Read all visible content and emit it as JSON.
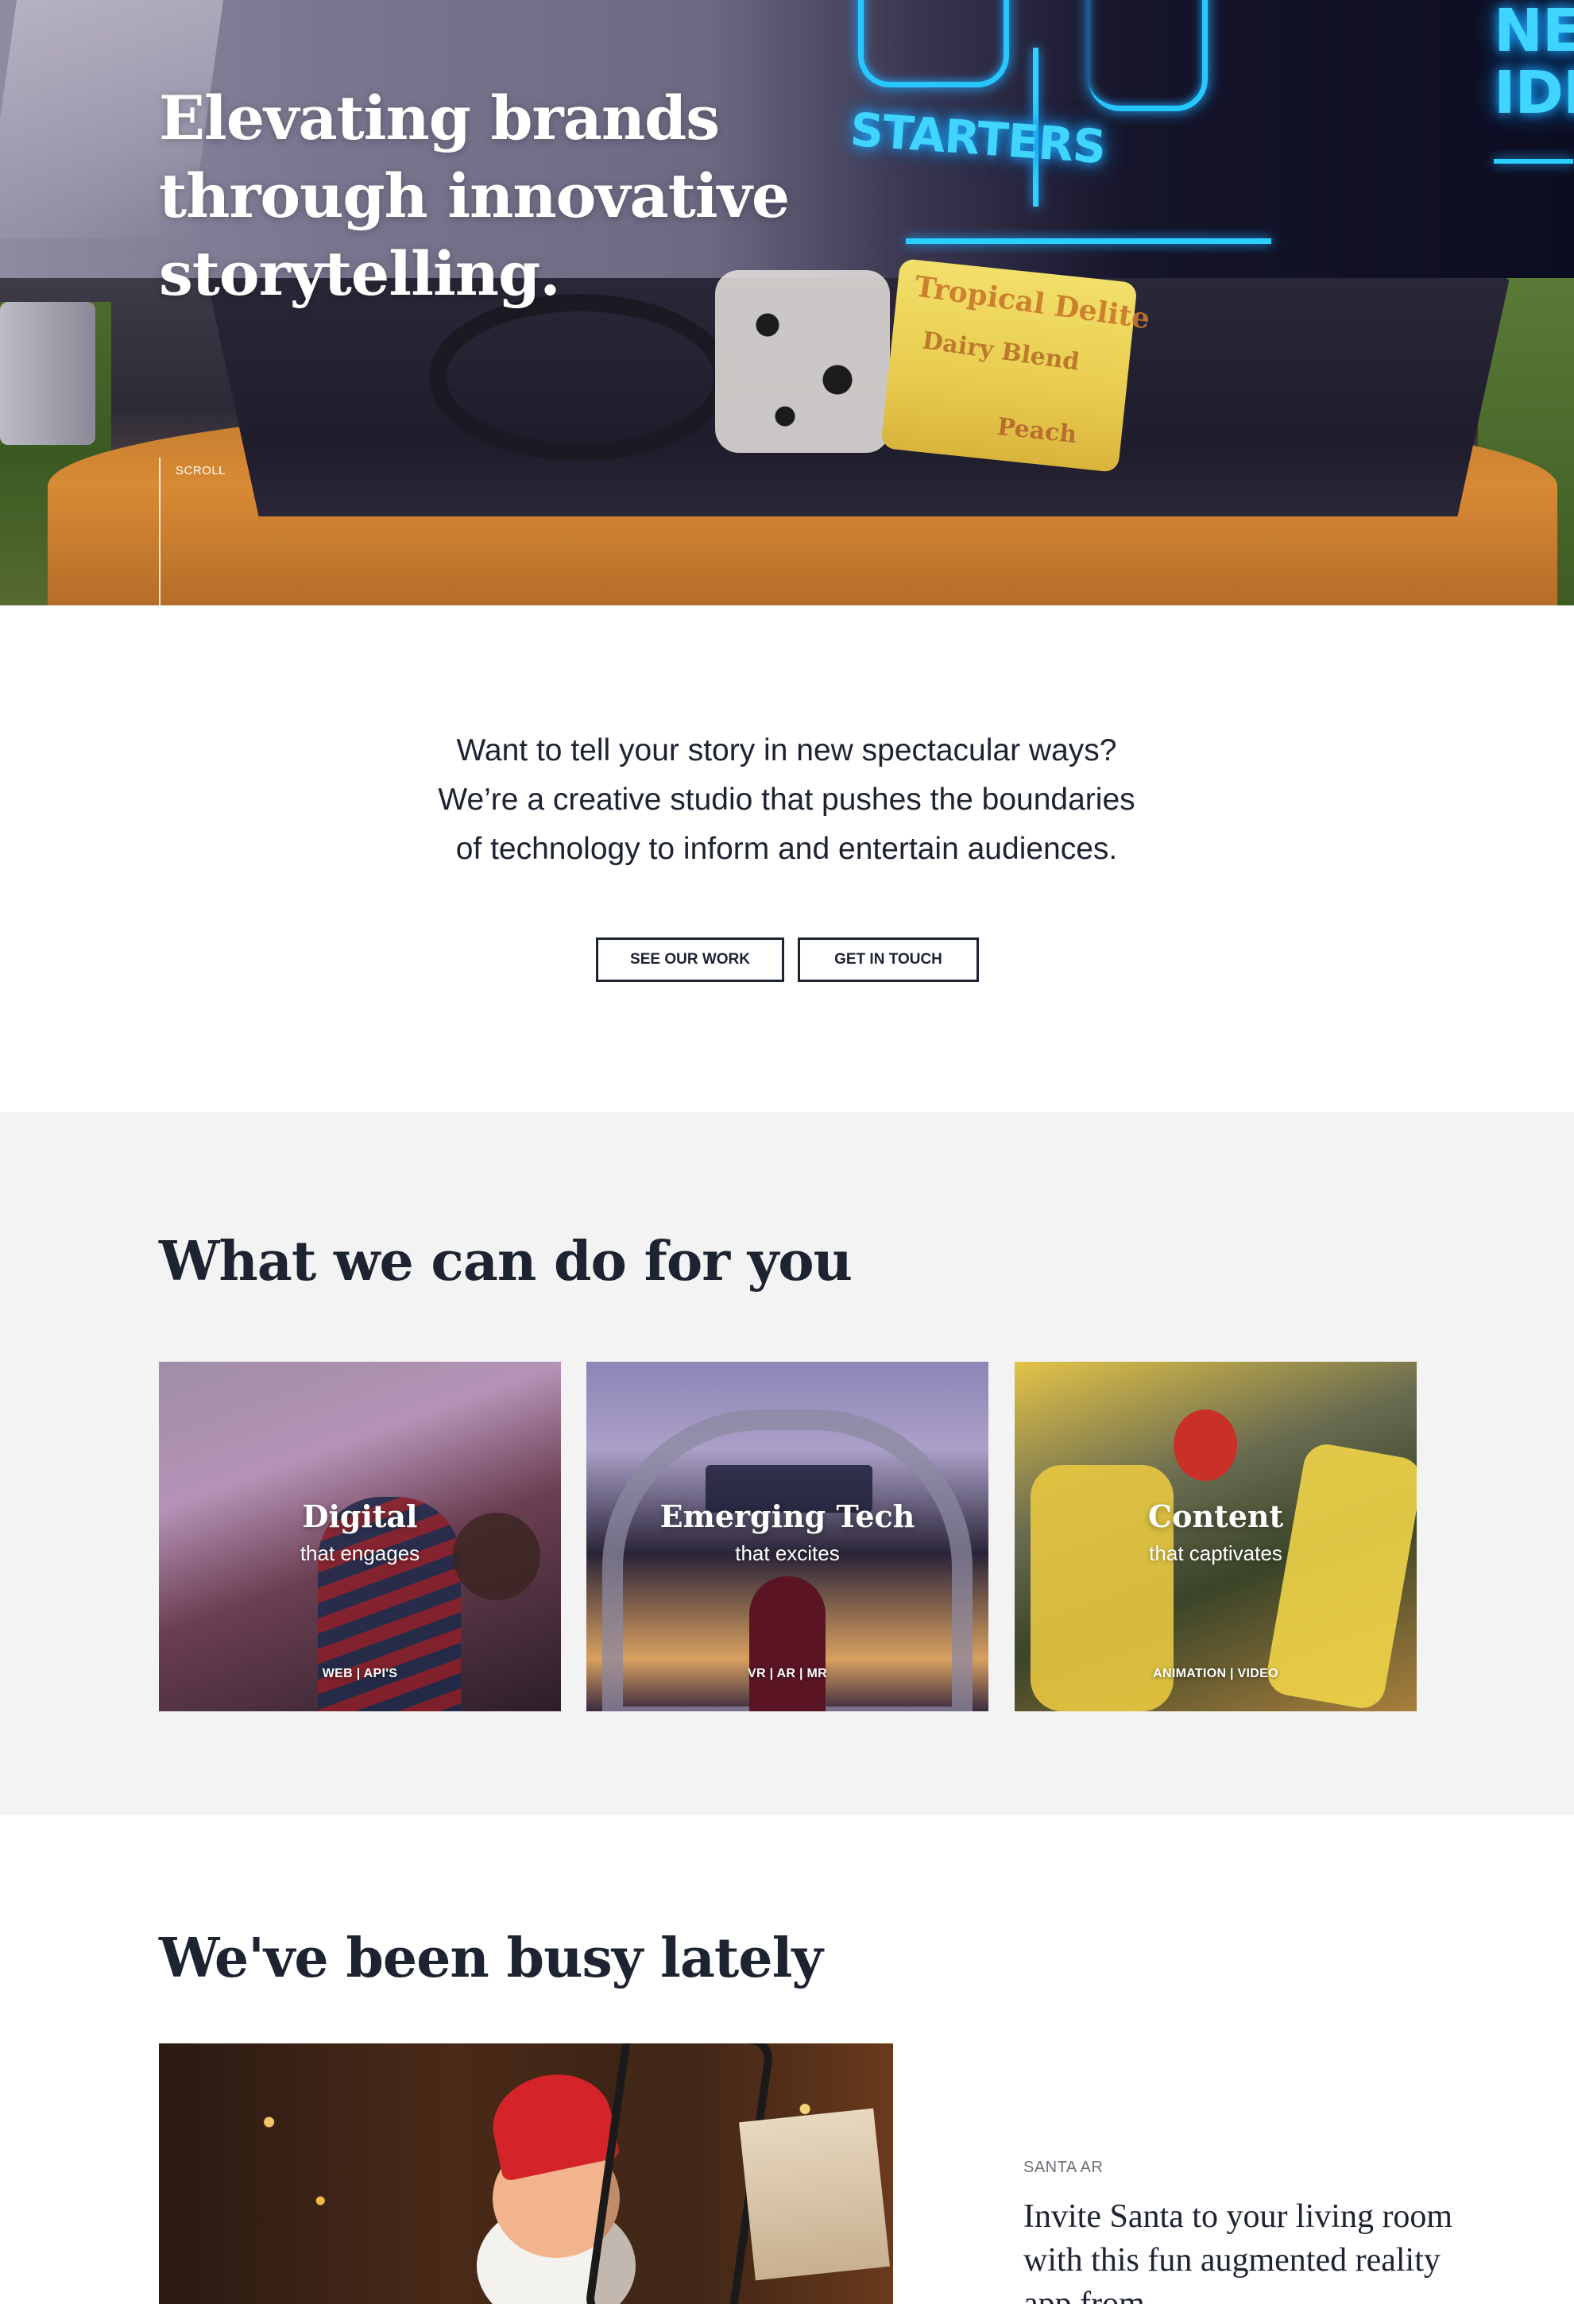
{
  "hero": {
    "title": "Elevating brands through innovative storytelling.",
    "scroll_label": "SCROLL",
    "neon_sign_text": "STARTERS",
    "neon_sign_partial": "NE IDE",
    "package_brand": "Tropical Delite",
    "package_flavor": "Dairy Blend",
    "package_variant": "Peach"
  },
  "intro": {
    "lines": [
      "Want to tell your story in new spectacular ways?",
      "We’re a creative studio that pushes the boundaries",
      "of technology to inform and entertain audiences."
    ],
    "buttons": {
      "see_work": "SEE OUR WORK",
      "get_in_touch": "GET IN TOUCH"
    }
  },
  "services": {
    "title": "What we can do for you",
    "cards": [
      {
        "title": "Digital",
        "subtitle": "that engages",
        "tags": "WEB  |  API'S"
      },
      {
        "title": "Emerging Tech",
        "subtitle": "that excites",
        "tags": "VR  |  AR  |  MR"
      },
      {
        "title": "Content",
        "subtitle": "that captivates",
        "tags": "ANIMATION  |  VIDEO"
      }
    ]
  },
  "busy": {
    "title": "We've been busy lately",
    "project": {
      "kicker": "SANTA AR",
      "title": "Invite Santa to your living room with this fun augmented reality app from"
    }
  },
  "colors": {
    "text_dark": "#1d2330",
    "section_bg": "#f3f3f3",
    "neon_blue": "#27c8ff",
    "muted": "#6b6f76"
  }
}
